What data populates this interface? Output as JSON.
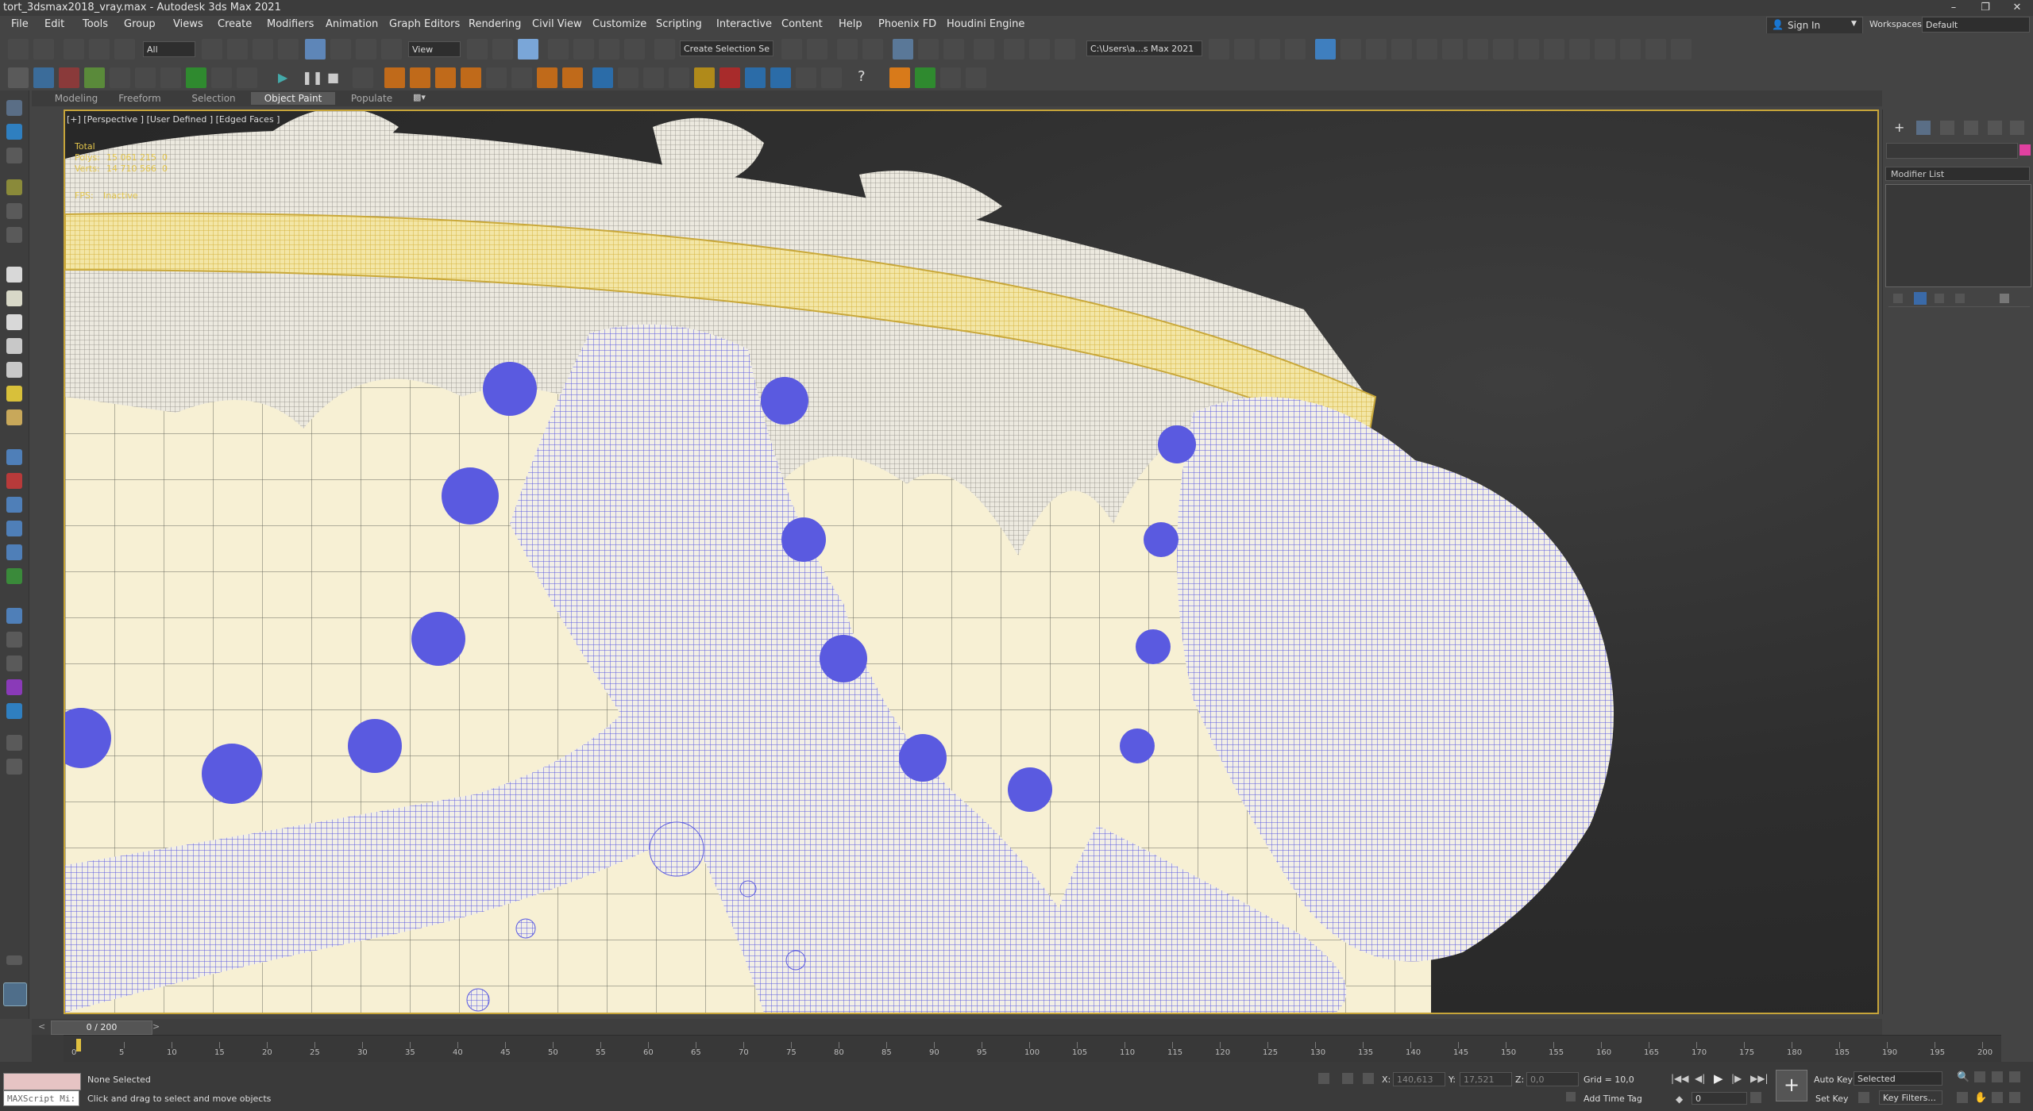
{
  "window": {
    "title": "tort_3dsmax2018_vray.max - Autodesk 3ds Max 2021"
  },
  "menu": [
    "File",
    "Edit",
    "Tools",
    "Group",
    "Views",
    "Create",
    "Modifiers",
    "Animation",
    "Graph Editors",
    "Rendering",
    "Civil View",
    "Customize",
    "Scripting",
    "Interactive",
    "Content",
    "Help",
    "Phoenix FD",
    "Houdini Engine"
  ],
  "account": {
    "sign_in": "Sign In",
    "workspaces_label": "Workspaces:",
    "workspace": "Default"
  },
  "toolbar": {
    "filter": "All",
    "ref_coord": "View",
    "selection_set": "Create Selection Se",
    "project_path": "C:\\Users\\a...s Max 2021"
  },
  "ribbon_tabs": [
    "Modeling",
    "Freeform",
    "Selection",
    "Object Paint",
    "Populate"
  ],
  "ribbon_active": "Object Paint",
  "viewport": {
    "label": "[+] [Perspective ] [User Defined ] [Edged Faces ]",
    "stats": {
      "total_label": "Total",
      "polys_label": "Polys:",
      "polys_value": "15 061 215",
      "polys_sel": "0",
      "verts_label": "Verts:",
      "verts_value": "14 710 566",
      "verts_sel": "0",
      "fps_label": "FPS:",
      "fps_value": "Inactive"
    }
  },
  "command_panel": {
    "modifier_list": "Modifier List"
  },
  "timeline": {
    "frame_readout": "0 / 200",
    "ticks": [
      0,
      5,
      10,
      15,
      20,
      25,
      30,
      35,
      40,
      45,
      50,
      55,
      60,
      65,
      70,
      75,
      80,
      85,
      90,
      95,
      100,
      105,
      110,
      115,
      120,
      125,
      130,
      135,
      140,
      145,
      150,
      155,
      160,
      165,
      170,
      175,
      180,
      185,
      190,
      195,
      200
    ]
  },
  "status": {
    "maxscript": "MAXScript Mi:",
    "selection": "None Selected",
    "prompt": "Click and drag to select and move objects",
    "x_label": "X:",
    "x_value": "140,613",
    "y_label": "Y:",
    "y_value": "17,521",
    "z_label": "Z:",
    "z_value": "0,0",
    "grid": "Grid = 10,0",
    "add_time_tag": "Add Time Tag",
    "auto_key": "Auto Key",
    "set_key": "Set Key",
    "selected_dd": "Selected",
    "key_filters": "Key Filters...",
    "frame_field": "0"
  },
  "colors": {
    "accent": "#c7a53a",
    "wire_blue": "#5a5ae0",
    "cake_cream": "#f5eecd",
    "wire_yellow": "#e8d477",
    "wire_gray": "#d9d6cc"
  }
}
